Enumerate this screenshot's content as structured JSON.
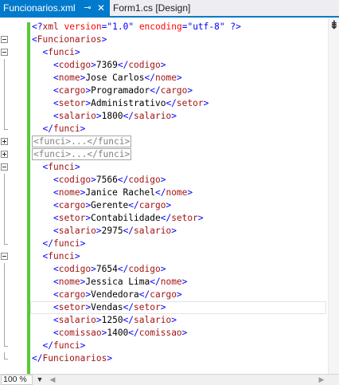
{
  "tabs": {
    "active_label": "Funcionarios.xml",
    "pin_glyph": "⊸",
    "close_glyph": "✕",
    "inactive_label": "Form1.cs [Design]"
  },
  "editor": {
    "lines": [
      {
        "fold": "none",
        "segments": [
          {
            "c": "p",
            "s": "<?"
          },
          {
            "c": "t",
            "s": "xml"
          },
          {
            "c": "x",
            "s": " "
          },
          {
            "c": "a",
            "s": "version"
          },
          {
            "c": "p",
            "s": "=\""
          },
          {
            "c": "v",
            "s": "1.0"
          },
          {
            "c": "p",
            "s": "\""
          },
          {
            "c": "x",
            "s": " "
          },
          {
            "c": "a",
            "s": "encoding"
          },
          {
            "c": "p",
            "s": "=\""
          },
          {
            "c": "v",
            "s": "utf-8"
          },
          {
            "c": "p",
            "s": "\""
          },
          {
            "c": "x",
            "s": " "
          },
          {
            "c": "p",
            "s": "?>"
          }
        ]
      },
      {
        "fold": "minus",
        "segments": [
          {
            "c": "p",
            "s": "<"
          },
          {
            "c": "t",
            "s": "Funcionarios"
          },
          {
            "c": "p",
            "s": ">"
          }
        ]
      },
      {
        "fold": "minus",
        "segments": [
          {
            "c": "x",
            "s": "  "
          },
          {
            "c": "p",
            "s": "<"
          },
          {
            "c": "t",
            "s": "funci"
          },
          {
            "c": "p",
            "s": ">"
          }
        ]
      },
      {
        "fold": "none",
        "segments": [
          {
            "c": "x",
            "s": "    "
          },
          {
            "c": "p",
            "s": "<"
          },
          {
            "c": "t",
            "s": "codigo"
          },
          {
            "c": "p",
            "s": ">"
          },
          {
            "c": "x",
            "s": "7369"
          },
          {
            "c": "p",
            "s": "</"
          },
          {
            "c": "t",
            "s": "codigo"
          },
          {
            "c": "p",
            "s": ">"
          }
        ]
      },
      {
        "fold": "none",
        "segments": [
          {
            "c": "x",
            "s": "    "
          },
          {
            "c": "p",
            "s": "<"
          },
          {
            "c": "t",
            "s": "nome"
          },
          {
            "c": "p",
            "s": ">"
          },
          {
            "c": "x",
            "s": "Jose Carlos"
          },
          {
            "c": "p",
            "s": "</"
          },
          {
            "c": "t",
            "s": "nome"
          },
          {
            "c": "p",
            "s": ">"
          }
        ]
      },
      {
        "fold": "none",
        "segments": [
          {
            "c": "x",
            "s": "    "
          },
          {
            "c": "p",
            "s": "<"
          },
          {
            "c": "t",
            "s": "cargo"
          },
          {
            "c": "p",
            "s": ">"
          },
          {
            "c": "x",
            "s": "Programador"
          },
          {
            "c": "p",
            "s": "</"
          },
          {
            "c": "t",
            "s": "cargo"
          },
          {
            "c": "p",
            "s": ">"
          }
        ]
      },
      {
        "fold": "none",
        "segments": [
          {
            "c": "x",
            "s": "    "
          },
          {
            "c": "p",
            "s": "<"
          },
          {
            "c": "t",
            "s": "setor"
          },
          {
            "c": "p",
            "s": ">"
          },
          {
            "c": "x",
            "s": "Administrativo"
          },
          {
            "c": "p",
            "s": "</"
          },
          {
            "c": "t",
            "s": "setor"
          },
          {
            "c": "p",
            "s": ">"
          }
        ]
      },
      {
        "fold": "none",
        "segments": [
          {
            "c": "x",
            "s": "    "
          },
          {
            "c": "p",
            "s": "<"
          },
          {
            "c": "t",
            "s": "salario"
          },
          {
            "c": "p",
            "s": ">"
          },
          {
            "c": "x",
            "s": "1800"
          },
          {
            "c": "p",
            "s": "</"
          },
          {
            "c": "t",
            "s": "salario"
          },
          {
            "c": "p",
            "s": ">"
          }
        ]
      },
      {
        "fold": "end",
        "segments": [
          {
            "c": "x",
            "s": "  "
          },
          {
            "c": "p",
            "s": "</"
          },
          {
            "c": "t",
            "s": "funci"
          },
          {
            "c": "p",
            "s": ">"
          }
        ]
      },
      {
        "fold": "plus",
        "segments": [
          {
            "c": "collapsed",
            "s": "<funci>...</funci>"
          }
        ]
      },
      {
        "fold": "plus",
        "segments": [
          {
            "c": "collapsed",
            "s": "<funci>...</funci>"
          }
        ]
      },
      {
        "fold": "minus",
        "segments": [
          {
            "c": "x",
            "s": "  "
          },
          {
            "c": "p",
            "s": "<"
          },
          {
            "c": "t",
            "s": "funci"
          },
          {
            "c": "p",
            "s": ">"
          }
        ]
      },
      {
        "fold": "none",
        "segments": [
          {
            "c": "x",
            "s": "    "
          },
          {
            "c": "p",
            "s": "<"
          },
          {
            "c": "t",
            "s": "codigo"
          },
          {
            "c": "p",
            "s": ">"
          },
          {
            "c": "x",
            "s": "7566"
          },
          {
            "c": "p",
            "s": "</"
          },
          {
            "c": "t",
            "s": "codigo"
          },
          {
            "c": "p",
            "s": ">"
          }
        ]
      },
      {
        "fold": "none",
        "segments": [
          {
            "c": "x",
            "s": "    "
          },
          {
            "c": "p",
            "s": "<"
          },
          {
            "c": "t",
            "s": "nome"
          },
          {
            "c": "p",
            "s": ">"
          },
          {
            "c": "x",
            "s": "Janice Rachel"
          },
          {
            "c": "p",
            "s": "</"
          },
          {
            "c": "t",
            "s": "nome"
          },
          {
            "c": "p",
            "s": ">"
          }
        ]
      },
      {
        "fold": "none",
        "segments": [
          {
            "c": "x",
            "s": "    "
          },
          {
            "c": "p",
            "s": "<"
          },
          {
            "c": "t",
            "s": "cargo"
          },
          {
            "c": "p",
            "s": ">"
          },
          {
            "c": "x",
            "s": "Gerente"
          },
          {
            "c": "p",
            "s": "</"
          },
          {
            "c": "t",
            "s": "cargo"
          },
          {
            "c": "p",
            "s": ">"
          }
        ]
      },
      {
        "fold": "none",
        "segments": [
          {
            "c": "x",
            "s": "    "
          },
          {
            "c": "p",
            "s": "<"
          },
          {
            "c": "t",
            "s": "setor"
          },
          {
            "c": "p",
            "s": ">"
          },
          {
            "c": "x",
            "s": "Contabilidade"
          },
          {
            "c": "p",
            "s": "</"
          },
          {
            "c": "t",
            "s": "setor"
          },
          {
            "c": "p",
            "s": ">"
          }
        ]
      },
      {
        "fold": "none",
        "segments": [
          {
            "c": "x",
            "s": "    "
          },
          {
            "c": "p",
            "s": "<"
          },
          {
            "c": "t",
            "s": "salario"
          },
          {
            "c": "p",
            "s": ">"
          },
          {
            "c": "x",
            "s": "2975"
          },
          {
            "c": "p",
            "s": "</"
          },
          {
            "c": "t",
            "s": "salario"
          },
          {
            "c": "p",
            "s": ">"
          }
        ]
      },
      {
        "fold": "end",
        "segments": [
          {
            "c": "x",
            "s": "  "
          },
          {
            "c": "p",
            "s": "</"
          },
          {
            "c": "t",
            "s": "funci"
          },
          {
            "c": "p",
            "s": ">"
          }
        ]
      },
      {
        "fold": "minus",
        "segments": [
          {
            "c": "x",
            "s": "  "
          },
          {
            "c": "p",
            "s": "<"
          },
          {
            "c": "t",
            "s": "funci"
          },
          {
            "c": "p",
            "s": ">"
          }
        ]
      },
      {
        "fold": "none",
        "segments": [
          {
            "c": "x",
            "s": "    "
          },
          {
            "c": "p",
            "s": "<"
          },
          {
            "c": "t",
            "s": "codigo"
          },
          {
            "c": "p",
            "s": ">"
          },
          {
            "c": "x",
            "s": "7654"
          },
          {
            "c": "p",
            "s": "</"
          },
          {
            "c": "t",
            "s": "codigo"
          },
          {
            "c": "p",
            "s": ">"
          }
        ]
      },
      {
        "fold": "none",
        "segments": [
          {
            "c": "x",
            "s": "    "
          },
          {
            "c": "p",
            "s": "<"
          },
          {
            "c": "t",
            "s": "nome"
          },
          {
            "c": "p",
            "s": ">"
          },
          {
            "c": "x",
            "s": "Jessica Lima"
          },
          {
            "c": "p",
            "s": "</"
          },
          {
            "c": "t",
            "s": "nome"
          },
          {
            "c": "p",
            "s": ">"
          }
        ]
      },
      {
        "fold": "none",
        "segments": [
          {
            "c": "x",
            "s": "    "
          },
          {
            "c": "p",
            "s": "<"
          },
          {
            "c": "t",
            "s": "cargo"
          },
          {
            "c": "p",
            "s": ">"
          },
          {
            "c": "x",
            "s": "Vendedora"
          },
          {
            "c": "p",
            "s": "</"
          },
          {
            "c": "t",
            "s": "cargo"
          },
          {
            "c": "p",
            "s": ">"
          }
        ]
      },
      {
        "fold": "none",
        "current": true,
        "segments": [
          {
            "c": "x",
            "s": "    "
          },
          {
            "c": "p",
            "s": "<"
          },
          {
            "c": "t",
            "s": "setor"
          },
          {
            "c": "p",
            "s": ">"
          },
          {
            "c": "x",
            "s": "Vendas"
          },
          {
            "c": "p",
            "s": "</"
          },
          {
            "c": "t",
            "s": "setor"
          },
          {
            "c": "p",
            "s": ">"
          }
        ]
      },
      {
        "fold": "none",
        "segments": [
          {
            "c": "x",
            "s": "    "
          },
          {
            "c": "p",
            "s": "<"
          },
          {
            "c": "t",
            "s": "salario"
          },
          {
            "c": "p",
            "s": ">"
          },
          {
            "c": "x",
            "s": "1250"
          },
          {
            "c": "p",
            "s": "</"
          },
          {
            "c": "t",
            "s": "salario"
          },
          {
            "c": "p",
            "s": ">"
          }
        ]
      },
      {
        "fold": "none",
        "segments": [
          {
            "c": "x",
            "s": "    "
          },
          {
            "c": "p",
            "s": "<"
          },
          {
            "c": "t",
            "s": "comissao"
          },
          {
            "c": "p",
            "s": ">"
          },
          {
            "c": "x",
            "s": "1400"
          },
          {
            "c": "p",
            "s": "</"
          },
          {
            "c": "t",
            "s": "comissao"
          },
          {
            "c": "p",
            "s": ">"
          }
        ]
      },
      {
        "fold": "end",
        "segments": [
          {
            "c": "x",
            "s": "  "
          },
          {
            "c": "p",
            "s": "</"
          },
          {
            "c": "t",
            "s": "funci"
          },
          {
            "c": "p",
            "s": ">"
          }
        ]
      },
      {
        "fold": "end",
        "segments": [
          {
            "c": "p",
            "s": "</"
          },
          {
            "c": "t",
            "s": "Funcionarios"
          },
          {
            "c": "p",
            "s": ">"
          }
        ]
      }
    ]
  },
  "scrollbar": {
    "splitter_glyph": "⇟"
  },
  "statusbar": {
    "zoom_value": "100 %",
    "zoom_arrow": "▼",
    "scroll_left": "◀",
    "scroll_right": "▶"
  },
  "colors": {
    "accent": "#007acc",
    "change_bar": "#57c93b",
    "tag": "#a31515",
    "punctuation": "#0000ff",
    "attribute": "#ff0000",
    "text": "#000000"
  }
}
